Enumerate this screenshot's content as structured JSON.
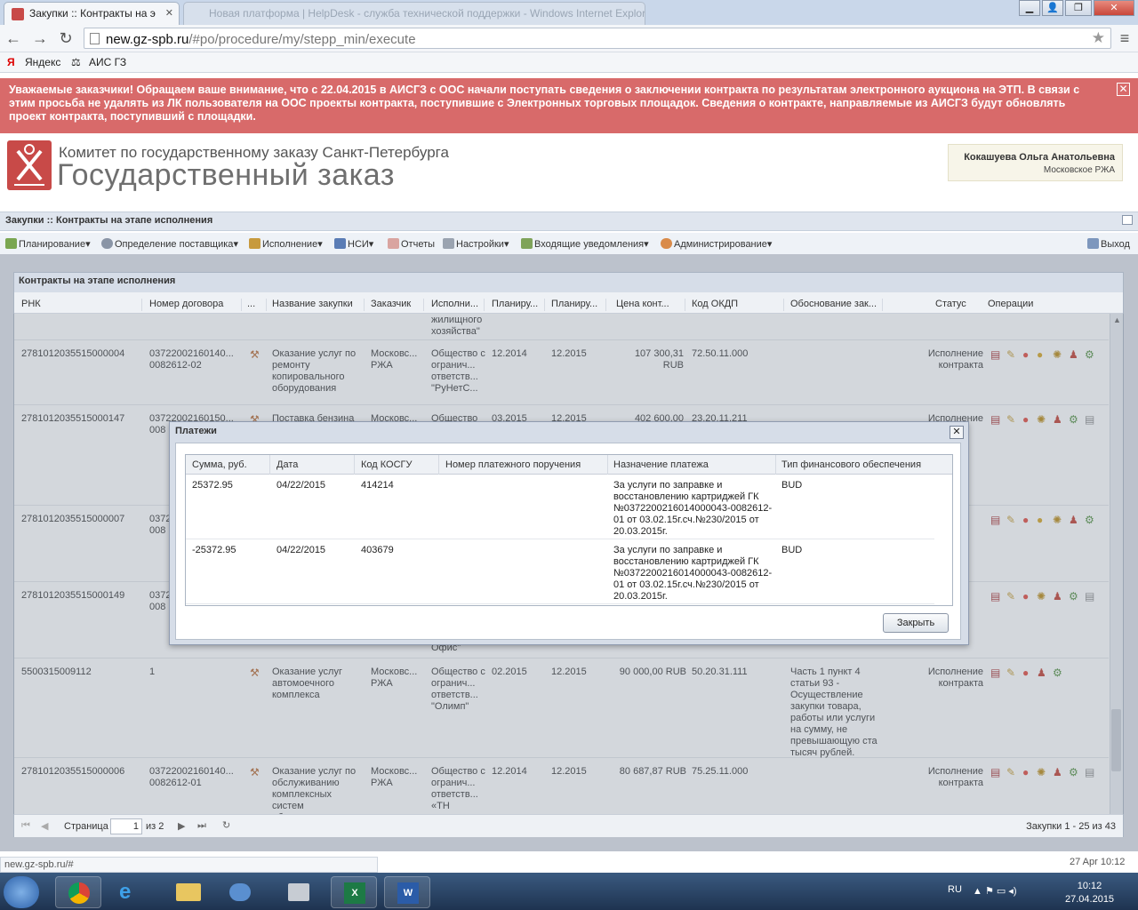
{
  "browser": {
    "tab1_title": "Закупки :: Контракты на э",
    "tab2_title": "Новая платформа | HelpDesk - служба технической поддержки - Windows Internet Explorer",
    "url_host": "new.gz-spb.ru",
    "url_path": "/#po/procedure/my/stepp_min/execute",
    "bookmarks": [
      "Яндекс",
      "АИС ГЗ"
    ],
    "status_url": "new.gz-spb.ru/#",
    "modified": "27 Apr 10:12"
  },
  "notice": {
    "text": "Уважаемые заказчики! Обращаем ваше внимание, что с 22.04.2015 в АИСГЗ с ООС начали поступать сведения о заключении контракта по результатам электронного аукциона на ЭТП. В связи с этим просьба не удалять из ЛК пользователя на ООС проекты контракта, поступившие с Электронных торговых площадок. Сведения о контракте, направляемые из АИСГЗ будут обновлять проект контракта, поступивший с площадки.",
    "close": "✕"
  },
  "header": {
    "org_line1": "Комитет по государственному заказу Санкт-Петербурга",
    "org_line2": "Государственный заказ",
    "user_name": "Кокашуева Ольга Анатольевна",
    "user_org": "Московское РЖА"
  },
  "app_title": "Закупки :: Контракты на этапе исполнения",
  "menu": {
    "planning": "Планирование",
    "supplier": "Определение поставщика",
    "execution": "Исполнение",
    "nsi": "НСИ",
    "reports": "Отчеты",
    "settings": "Настройки",
    "notifications": "Входящие уведомления",
    "admin": "Администрирование",
    "logout": "Выход"
  },
  "panel": {
    "title": "Контракты на этапе исполнения",
    "columns": [
      "РНК",
      "Номер договора",
      "...",
      "Название закупки",
      "Заказчик",
      "Исполни...",
      "Планиру...",
      "Планиру...",
      "Цена конт...",
      "Код ОКДП",
      "Обоснование зак...",
      "Статус",
      "Операции"
    ],
    "rows": [
      {
        "rnk": "",
        "num": "",
        "name": "",
        "customer": "",
        "exec": "жилищного хозяйства\"",
        "p1": "",
        "p2": "",
        "price": "",
        "okdp": "",
        "basis": "",
        "status": ""
      },
      {
        "rnk": "2781012035515000004",
        "num": "03722002160140... 0082612-02",
        "name": "Оказание услуг по ремонту копировального оборудования",
        "customer": "Московс... РЖА",
        "exec": "Общество с огранич... ответств... \"РуНетС...",
        "p1": "12.2014",
        "p2": "12.2015",
        "price": "107 300,31 RUB",
        "okdp": "72.50.11.000",
        "basis": "",
        "status": "Исполнение контракта"
      },
      {
        "rnk": "2781012035515000147",
        "num": "03722002160150... 008",
        "name": "Поставка бензина",
        "customer": "Московс...",
        "exec": "Общество",
        "p1": "03.2015",
        "p2": "12.2015",
        "price": "402 600,00",
        "okdp": "23.20.11.211",
        "basis": "",
        "status": "Исполнение"
      },
      {
        "rnk": "2781012035515000007",
        "num": "0372 008",
        "name": "",
        "customer": "",
        "exec": "",
        "p1": "",
        "p2": "",
        "price": "",
        "okdp": "",
        "basis": "",
        "status": ""
      },
      {
        "rnk": "2781012035515000149",
        "num": "0372 008",
        "name": "",
        "customer": "",
        "exec": "Офис\"",
        "p1": "",
        "p2": "",
        "price": "",
        "okdp": "",
        "basis": "",
        "status": ""
      },
      {
        "rnk": "5500315009112",
        "num": "1",
        "name": "Оказание услуг автомоечного комплекса",
        "customer": "Московс... РЖА",
        "exec": "Общество с огранич... ответств... \"Олимп\"",
        "p1": "02.2015",
        "p2": "12.2015",
        "price": "90 000,00 RUB",
        "okdp": "50.20.31.111",
        "basis": "Часть 1 пункт 4 статьи 93 - Осуществление закупки товара, работы или услуги на сумму, не превышающую ста тысяч рублей.",
        "status": "Исполнение контракта"
      },
      {
        "rnk": "2781012035515000006",
        "num": "03722002160140... 0082612-01",
        "name": "Оказание услуг по обслуживанию комплексных систем обеспечения",
        "customer": "Московс... РЖА",
        "exec": "Общество с огранич... ответств... «ТН",
        "p1": "12.2014",
        "p2": "12.2015",
        "price": "80 687,87 RUB",
        "okdp": "75.25.11.000",
        "basis": "",
        "status": "Исполнение контракта"
      }
    ]
  },
  "pager": {
    "page_label": "Страница",
    "page_value": "1",
    "of_label": "из 2",
    "summary": "Закупки 1 - 25 из 43"
  },
  "modal": {
    "title": "Платежи",
    "columns": [
      "Сумма, руб.",
      "Дата",
      "Код КОСГУ",
      "Номер платежного поручения",
      "Назначение платежа",
      "Тип финансового обеспечения"
    ],
    "rows": [
      {
        "sum": "25372.95",
        "date": "04/22/2015",
        "kosgu": "414214",
        "order": "",
        "purpose": "За услуги по заправке и восстановлению картриджей ГК №0372200216014000043-0082612-01 от 03.02.15г.сч.№230/2015 от 20.03.2015г.",
        "type": "BUD"
      },
      {
        "sum": "-25372.95",
        "date": "04/22/2015",
        "kosgu": "403679",
        "order": "",
        "purpose": "За услуги по заправке и восстановлению картриджей ГК №0372200216014000043-0082612-01 от 03.02.15г.сч.№230/2015 от 20.03.2015г.",
        "type": "BUD"
      }
    ],
    "close_label": "Закрыть"
  },
  "taskbar": {
    "lang": "RU",
    "time": "10:12",
    "date": "27.04.2015"
  },
  "colors": {
    "notice_bg": "#d86a6a",
    "accent_icon": "#c0392b"
  }
}
